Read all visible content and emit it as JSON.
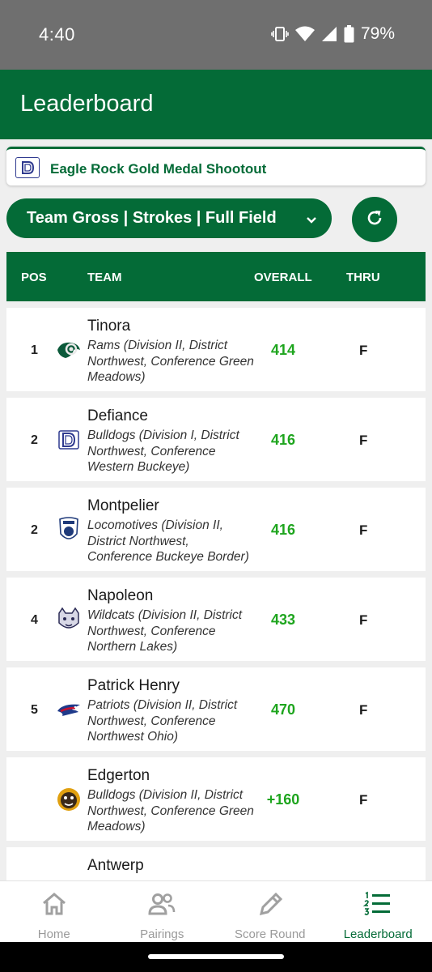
{
  "status": {
    "time": "4:40",
    "battery": "79%",
    "icons": [
      "vibrate-icon",
      "wifi-icon",
      "signal-icon",
      "battery-icon"
    ]
  },
  "app_bar": {
    "title": "Leaderboard"
  },
  "event": {
    "name": "Eagle Rock Gold Medal Shootout",
    "logo_icon": "defiance-d-logo-icon"
  },
  "filter": {
    "label": "Team Gross | Strokes | Full Field",
    "chevron_icon": "chevron-down-icon"
  },
  "refresh": {
    "icon": "refresh-icon"
  },
  "table": {
    "headers": {
      "pos": "POS",
      "team": "TEAM",
      "overall": "OVERALL",
      "thru": "THRU"
    },
    "rows": [
      {
        "pos": "1",
        "name": "Tinora",
        "details": "Rams (Division II, District Northwest, Conference Green Meadows)",
        "overall": "414",
        "thru": "F",
        "logo": "ram-logo-icon"
      },
      {
        "pos": "2",
        "name": "Defiance",
        "details": "Bulldogs (Division I, District Northwest, Conference Western Buckeye)",
        "overall": "416",
        "thru": "F",
        "logo": "defiance-d-logo-icon"
      },
      {
        "pos": "2",
        "name": "Montpelier",
        "details": "Locomotives (Division II, District Northwest, Conference Buckeye Border)",
        "overall": "416",
        "thru": "F",
        "logo": "locomotive-logo-icon"
      },
      {
        "pos": "4",
        "name": "Napoleon",
        "details": "Wildcats (Division II, District Northwest, Conference Northern Lakes)",
        "overall": "433",
        "thru": "F",
        "logo": "wildcat-logo-icon"
      },
      {
        "pos": "5",
        "name": "Patrick Henry",
        "details": "Patriots (Division II, District Northwest, Conference Northwest Ohio)",
        "overall": "470",
        "thru": "F",
        "logo": "patriot-logo-icon"
      },
      {
        "pos": "",
        "name": "Edgerton",
        "details": "Bulldogs (Division II, District Northwest, Conference Green Meadows)",
        "overall": "+160",
        "thru": "F",
        "logo": "bulldog-logo-icon"
      },
      {
        "pos": "",
        "name": "Antwerp",
        "details": "",
        "overall": "",
        "thru": "",
        "logo": ""
      }
    ]
  },
  "nav": {
    "items": [
      {
        "label": "Home",
        "icon": "home-icon"
      },
      {
        "label": "Pairings",
        "icon": "people-icon"
      },
      {
        "label": "Score Round",
        "icon": "pencil-icon"
      },
      {
        "label": "Leaderboard",
        "icon": "numbered-list-icon"
      }
    ],
    "active": "Leaderboard"
  },
  "colors": {
    "primary": "#046b37",
    "score_green": "#1ea51e",
    "status_bar": "#6f6f6f",
    "background": "#efefef"
  }
}
